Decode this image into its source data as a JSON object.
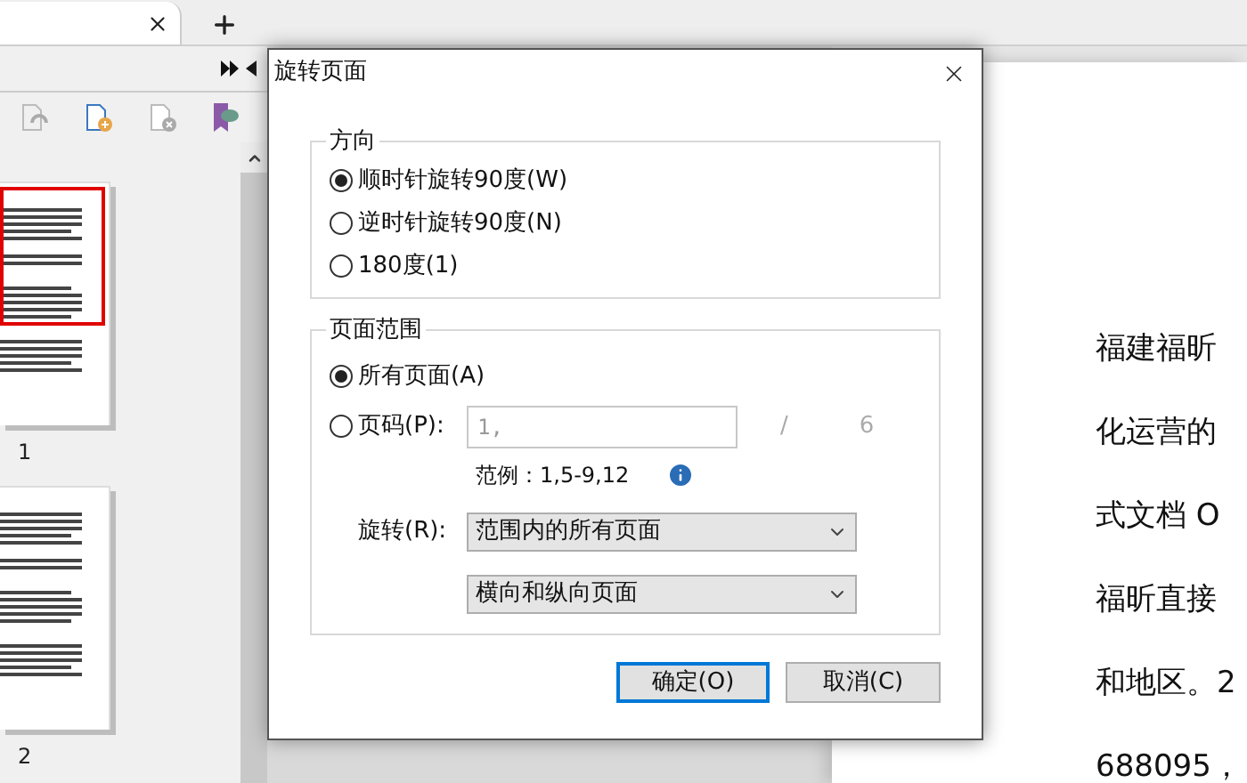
{
  "thumbnails": [
    {
      "label": "1",
      "selected": true
    },
    {
      "label": "2",
      "selected": false
    }
  ],
  "document_lines": [
    "福建福昕",
    "化运营的",
    "式文档 O",
    "福昕直接",
    "和地区。2",
    "688095，"
  ],
  "dialog": {
    "title": "旋转页面",
    "direction": {
      "legend": "方向",
      "options": [
        {
          "label": "顺时针旋转90度(W)",
          "selected": true
        },
        {
          "label": "逆时针旋转90度(N)",
          "selected": false
        },
        {
          "label": "180度(1)",
          "selected": false
        }
      ]
    },
    "page_range": {
      "legend": "页面范围",
      "options": [
        {
          "label": "所有页面(A)",
          "selected": true
        },
        {
          "label": "页码(P):",
          "selected": false
        }
      ],
      "pages_value": "1,",
      "separator": "/",
      "total_pages": "6",
      "example": "范例：1,5-9,12",
      "rotate_label": "旋转(R):",
      "rotate_scope": "范围内的所有页面",
      "orientation": "横向和纵向页面"
    },
    "buttons": [
      {
        "label": "确定(O)",
        "default": true
      },
      {
        "label": "取消(C)",
        "default": false
      }
    ]
  }
}
